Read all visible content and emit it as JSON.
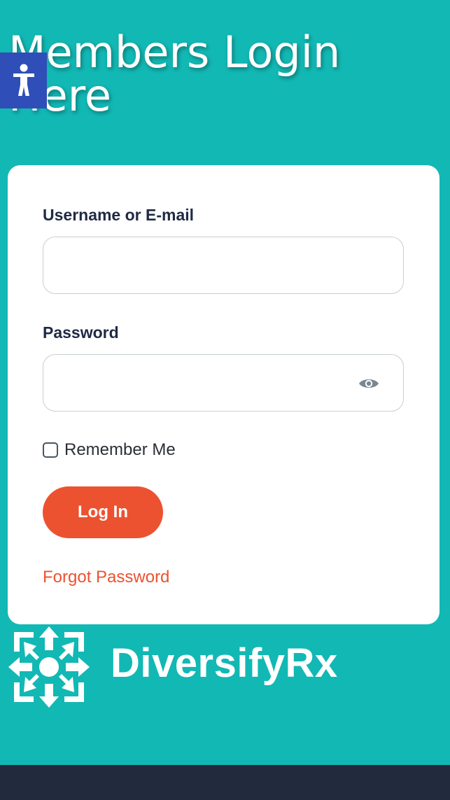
{
  "page": {
    "title": "Members Login Here"
  },
  "login_form": {
    "username_label": "Username or E-mail",
    "username_value": "",
    "password_label": "Password",
    "password_value": "",
    "remember_label": "Remember Me",
    "remember_checked": false,
    "login_button": "Log In",
    "forgot_link": "Forgot Password"
  },
  "brand": {
    "name": "DiversifyRx"
  },
  "icons": {
    "accessibility": "accessibility-person-icon",
    "password_toggle": "eye-icon",
    "logo": "diversifyrx-logo-icon"
  },
  "colors": {
    "background": "#12b8b4",
    "card": "#ffffff",
    "accent": "#ec5230",
    "label": "#1f2a44",
    "accessibility_button": "#2f4eb8",
    "footer": "#222a3d"
  }
}
